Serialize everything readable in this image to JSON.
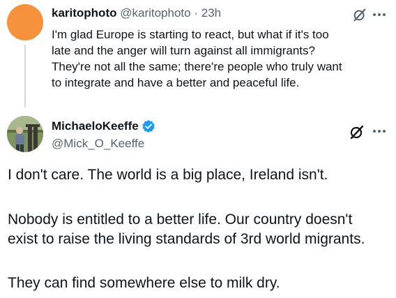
{
  "parent_tweet": {
    "author_name": "karitophoto",
    "handle": "@karitophoto",
    "separator": "·",
    "time": "23h",
    "text_lines": [
      "I'm glad Europe is starting to react, but what if it's too",
      "late and the anger will turn against all immigrants?",
      "They're not all the same; there're people who truly want",
      "to integrate and have a better and peaceful life."
    ],
    "avatar_color": "#f6913c",
    "icons": [
      "grok-icon",
      "more-options-icon"
    ]
  },
  "main_tweet": {
    "author_name": "MichaeloKeeffe",
    "handle": "@Mick_O_Keeffe",
    "verified": true,
    "verified_color": "#1d9bf0",
    "text_lines": [
      "I don't care. The world is a big place, Ireland isn't.",
      "Nobody is entitled to a better life. Our country doesn't",
      "exist to raise the living standards of 3rd world migrants.",
      "They can find somewhere else to milk dry."
    ],
    "icons": [
      "verified-badge-icon",
      "grok-icon",
      "more-options-icon"
    ]
  },
  "colors": {
    "text": "#0f1419",
    "secondary_text": "#536471",
    "thread_line": "#cfd9de"
  }
}
